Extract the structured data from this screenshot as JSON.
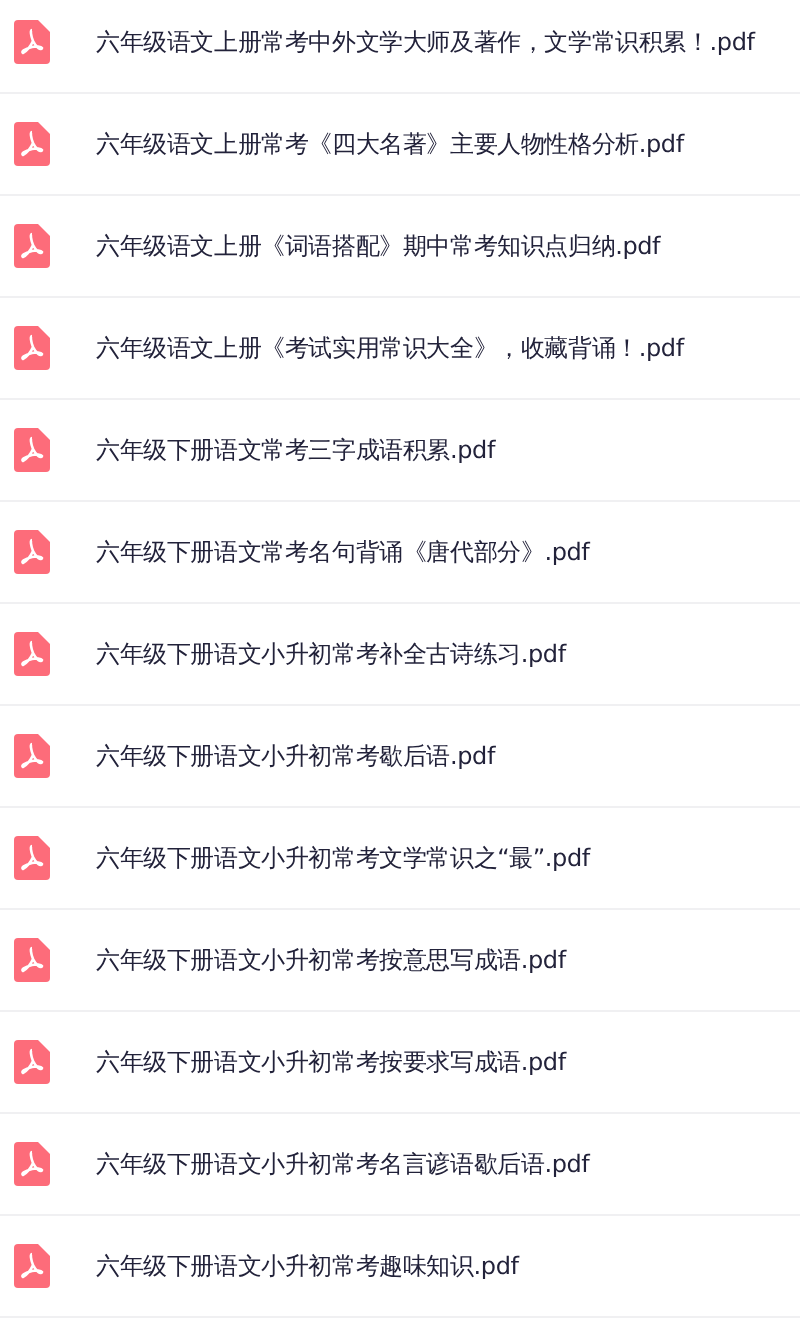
{
  "files": [
    {
      "name": "六年级语文上册常考中外文学大师及著作，文学常识积累！.pdf"
    },
    {
      "name": "六年级语文上册常考《四大名著》主要人物性格分析.pdf"
    },
    {
      "name": "六年级语文上册《词语搭配》期中常考知识点归纳.pdf"
    },
    {
      "name": "六年级语文上册《考试实用常识大全》，收藏背诵！.pdf"
    },
    {
      "name": "六年级下册语文常考三字成语积累.pdf"
    },
    {
      "name": "六年级下册语文常考名句背诵《唐代部分》.pdf"
    },
    {
      "name": "六年级下册语文小升初常考补全古诗练习.pdf"
    },
    {
      "name": "六年级下册语文小升初常考歇后语.pdf"
    },
    {
      "name": "六年级下册语文小升初常考文学常识之“最”.pdf"
    },
    {
      "name": "六年级下册语文小升初常考按意思写成语.pdf"
    },
    {
      "name": "六年级下册语文小升初常考按要求写成语.pdf"
    },
    {
      "name": "六年级下册语文小升初常考名言谚语歇后语.pdf"
    },
    {
      "name": "六年级下册语文小升初常考趣味知识.pdf"
    }
  ]
}
